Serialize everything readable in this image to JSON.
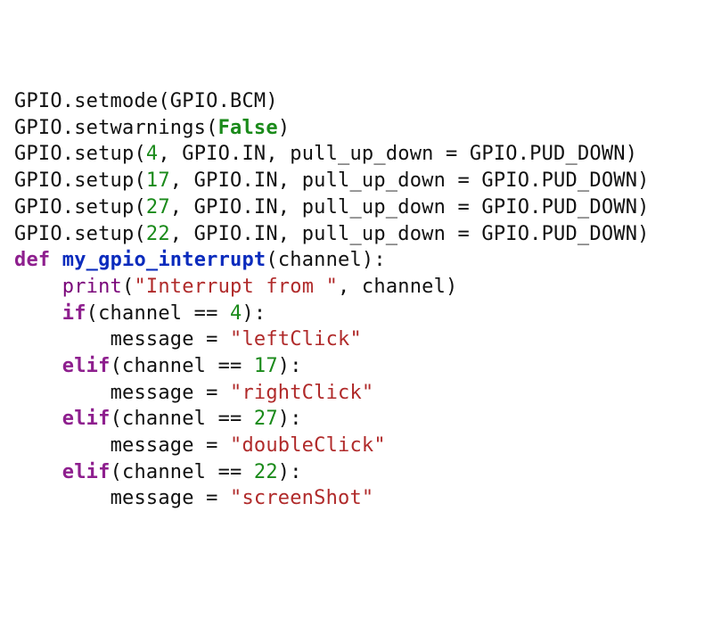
{
  "lines": [
    {
      "indent": 0,
      "tokens": [
        {
          "t": "GPIO.setmode(GPIO.BCM)",
          "c": "plain"
        }
      ]
    },
    {
      "indent": 0,
      "tokens": [
        {
          "t": "GPIO.setwarnings(",
          "c": "plain"
        },
        {
          "t": "False",
          "c": "bool"
        },
        {
          "t": ")",
          "c": "plain"
        }
      ]
    },
    {
      "indent": 0,
      "tokens": [
        {
          "t": "GPIO.setup(",
          "c": "plain"
        },
        {
          "t": "4",
          "c": "number"
        },
        {
          "t": ", GPIO.IN, pull_up_down = GPIO.PUD_DOWN)",
          "c": "plain"
        }
      ]
    },
    {
      "indent": 0,
      "tokens": [
        {
          "t": "GPIO.setup(",
          "c": "plain"
        },
        {
          "t": "17",
          "c": "number"
        },
        {
          "t": ", GPIO.IN, pull_up_down = GPIO.PUD_DOWN)",
          "c": "plain"
        }
      ]
    },
    {
      "indent": 0,
      "tokens": [
        {
          "t": "GPIO.setup(",
          "c": "plain"
        },
        {
          "t": "27",
          "c": "number"
        },
        {
          "t": ", GPIO.IN, pull_up_down = GPIO.PUD_DOWN)",
          "c": "plain"
        }
      ]
    },
    {
      "indent": 0,
      "tokens": [
        {
          "t": "GPIO.setup(",
          "c": "plain"
        },
        {
          "t": "22",
          "c": "number"
        },
        {
          "t": ", GPIO.IN, pull_up_down = GPIO.PUD_DOWN)",
          "c": "plain"
        }
      ]
    },
    {
      "indent": 0,
      "tokens": [
        {
          "t": "",
          "c": "plain"
        }
      ]
    },
    {
      "indent": 0,
      "tokens": [
        {
          "t": "def",
          "c": "keyword"
        },
        {
          "t": " ",
          "c": "plain"
        },
        {
          "t": "my_gpio_interrupt",
          "c": "funcdef"
        },
        {
          "t": "(channel):",
          "c": "plain"
        }
      ]
    },
    {
      "indent": 1,
      "tokens": [
        {
          "t": "print",
          "c": "builtin"
        },
        {
          "t": "(",
          "c": "plain"
        },
        {
          "t": "\"Interrupt from \"",
          "c": "string"
        },
        {
          "t": ", channel)",
          "c": "plain"
        }
      ]
    },
    {
      "indent": 1,
      "tokens": [
        {
          "t": "if",
          "c": "keyword"
        },
        {
          "t": "(channel == ",
          "c": "plain"
        },
        {
          "t": "4",
          "c": "number"
        },
        {
          "t": "):",
          "c": "plain"
        }
      ]
    },
    {
      "indent": 2,
      "tokens": [
        {
          "t": "message = ",
          "c": "plain"
        },
        {
          "t": "\"leftClick\"",
          "c": "string"
        }
      ]
    },
    {
      "indent": 1,
      "tokens": [
        {
          "t": "elif",
          "c": "keyword"
        },
        {
          "t": "(channel == ",
          "c": "plain"
        },
        {
          "t": "17",
          "c": "number"
        },
        {
          "t": "):",
          "c": "plain"
        }
      ]
    },
    {
      "indent": 2,
      "tokens": [
        {
          "t": "message = ",
          "c": "plain"
        },
        {
          "t": "\"rightClick\"",
          "c": "string"
        }
      ]
    },
    {
      "indent": 1,
      "tokens": [
        {
          "t": "elif",
          "c": "keyword"
        },
        {
          "t": "(channel == ",
          "c": "plain"
        },
        {
          "t": "27",
          "c": "number"
        },
        {
          "t": "):",
          "c": "plain"
        }
      ]
    },
    {
      "indent": 2,
      "tokens": [
        {
          "t": "message = ",
          "c": "plain"
        },
        {
          "t": "\"doubleClick\"",
          "c": "string"
        }
      ]
    },
    {
      "indent": 1,
      "tokens": [
        {
          "t": "elif",
          "c": "keyword"
        },
        {
          "t": "(channel == ",
          "c": "plain"
        },
        {
          "t": "22",
          "c": "number"
        },
        {
          "t": "):",
          "c": "plain"
        }
      ]
    },
    {
      "indent": 2,
      "tokens": [
        {
          "t": "message = ",
          "c": "plain"
        },
        {
          "t": "\"screenShot\"",
          "c": "string"
        }
      ]
    }
  ],
  "indent_unit": "    "
}
